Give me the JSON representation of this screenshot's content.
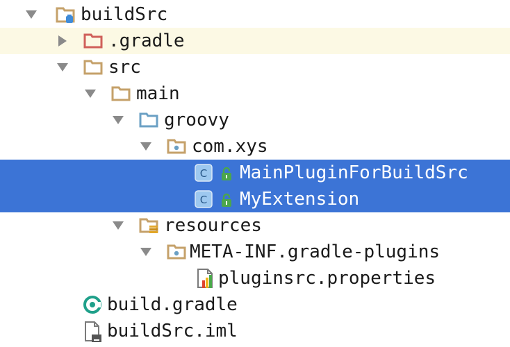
{
  "tree": {
    "items": [
      {
        "label": "buildSrc",
        "icon": "module-folder-icon",
        "expanded": true
      },
      {
        "label": ".gradle",
        "icon": "excluded-folder-icon",
        "expanded": false
      },
      {
        "label": "src",
        "icon": "folder-icon",
        "expanded": true
      },
      {
        "label": "main",
        "icon": "folder-icon",
        "expanded": true
      },
      {
        "label": "groovy",
        "icon": "source-folder-icon",
        "expanded": true
      },
      {
        "label": "com.xys",
        "icon": "package-icon",
        "expanded": true
      },
      {
        "label": "MainPluginForBuildSrc",
        "icon": "class-icon",
        "selected": true
      },
      {
        "label": "MyExtension",
        "icon": "class-icon",
        "selected": true
      },
      {
        "label": "resources",
        "icon": "resources-folder-icon",
        "expanded": true
      },
      {
        "label": "META-INF.gradle-plugins",
        "icon": "package-icon",
        "expanded": true
      },
      {
        "label": "pluginsrc.properties",
        "icon": "properties-file-icon"
      },
      {
        "label": "build.gradle",
        "icon": "gradle-icon"
      },
      {
        "label": "buildSrc.iml",
        "icon": "iml-file-icon"
      }
    ]
  },
  "colors": {
    "selection": "#3c74d6",
    "hover_row": "#fcf9e4",
    "folder": "#c5a16a",
    "source_folder": "#6ba0c4",
    "excluded_folder": "#d0605a",
    "class_badge": "#9dc8ef",
    "lock": "#4ca64c"
  }
}
